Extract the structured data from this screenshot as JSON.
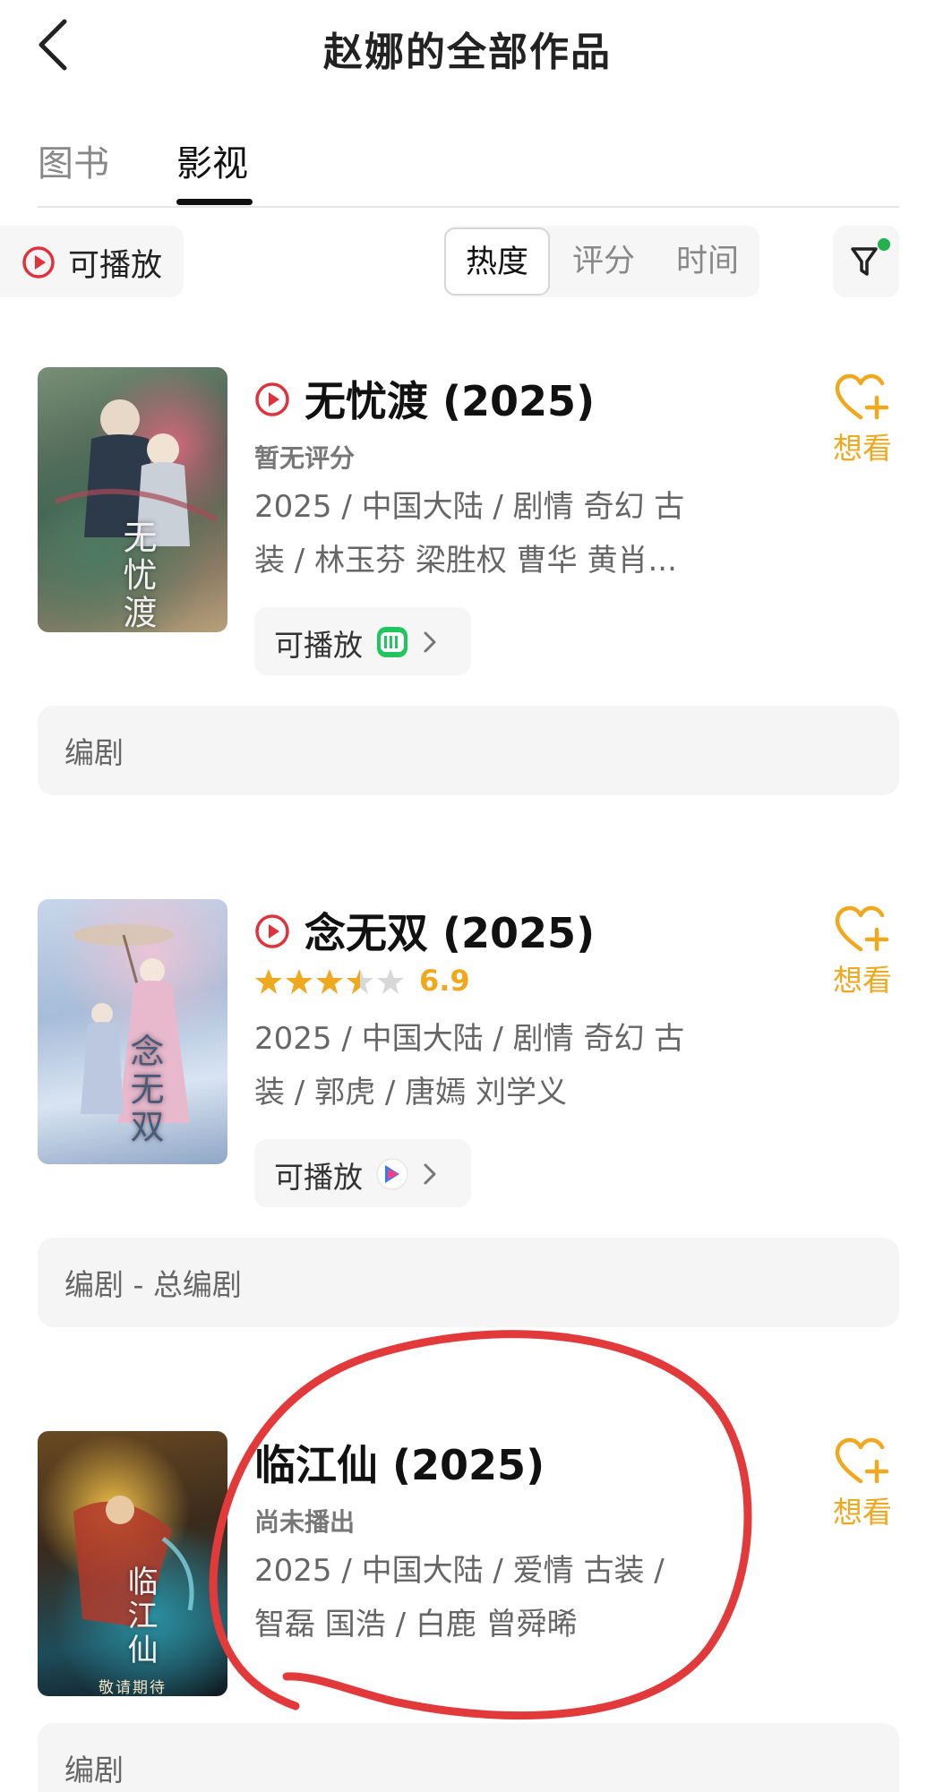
{
  "header": {
    "title": "赵娜的全部作品",
    "back_icon": "chevron-left-icon"
  },
  "tabs": [
    {
      "label": "图书",
      "active": false
    },
    {
      "label": "影视",
      "active": true
    }
  ],
  "filters": {
    "playable_label": "可播放",
    "sort_options": [
      {
        "label": "热度",
        "active": true
      },
      {
        "label": "评分",
        "active": false
      },
      {
        "label": "时间",
        "active": false
      }
    ],
    "filter_icon": "filter-funnel-icon",
    "filter_active_dot_color": "#22b14c"
  },
  "accent_color": "#f0a81e",
  "play_icon_color": "#e0323c",
  "works": [
    {
      "title": "无忧渡 (2025)",
      "poster_title": "无忧渡",
      "playable_title_icon": true,
      "rating_text": "暂无评分",
      "stars": null,
      "score": null,
      "meta_line1": "2025 / 中国大陆 / 剧情 奇幻 古",
      "meta_line2": "装 / 林玉芬 梁胜权 曹华 黄肖...",
      "want_label": "想看",
      "play_chip": {
        "label": "可播放",
        "platform_icon": "iqiyi-logo-icon"
      },
      "role": "编剧"
    },
    {
      "title": "念无双 (2025)",
      "poster_title": "念无双",
      "playable_title_icon": true,
      "rating_text": null,
      "stars": 3.5,
      "score": "6.9",
      "meta_line1": "2025 / 中国大陆 / 剧情 奇幻 古",
      "meta_line2": "装 / 郭虎 / 唐嫣 刘学义",
      "want_label": "想看",
      "play_chip": {
        "label": "可播放",
        "platform_icon": "youku-logo-icon"
      },
      "role": "编剧 - 总编剧"
    },
    {
      "title": "临江仙 (2025)",
      "poster_title": "临江仙",
      "poster_caption": "敬请期待",
      "playable_title_icon": false,
      "rating_text": "尚未播出",
      "stars": null,
      "score": null,
      "meta_line1": "2025 / 中国大陆 / 爱情 古装 /",
      "meta_line2": "智磊 国浩 / 白鹿 曾舜晞",
      "want_label": "想看",
      "play_chip": null,
      "role": "编剧"
    }
  ]
}
